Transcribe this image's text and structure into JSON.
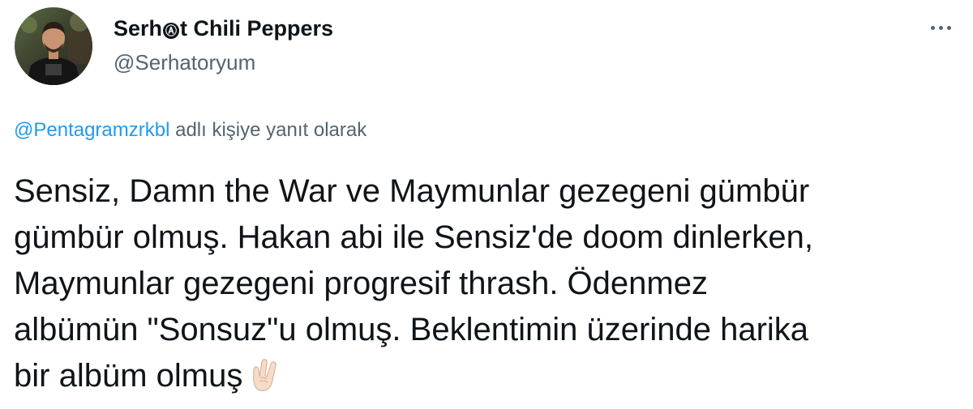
{
  "author": {
    "name_before": "Serh",
    "name_symbol": "Ⓐ",
    "name_after": "t Chili Peppers",
    "handle": "@Serhatoryum"
  },
  "reply": {
    "mention": "@Pentagramzrkbl",
    "suffix": " adlı kişiye yanıt olarak"
  },
  "tweet": {
    "text": "Sensiz, Damn the War ve Maymunlar gezegeni gümbür\ngümbür olmuş. Hakan abi ile Sensiz'de doom dinlerken,\nMaymunlar gezegeni progresif thrash. Ödenmez\nalbümün \"Sonsuz\"u olmuş. Beklentimin üzerinde harika\nbir albüm olmuş",
    "emoji": "horns-gesture-emoji"
  },
  "icons": {
    "more": "more-options-icon",
    "avatar": "avatar"
  },
  "colors": {
    "text": "#0f1419",
    "secondary": "#536471",
    "link": "#1d9bf0",
    "background": "#ffffff"
  }
}
